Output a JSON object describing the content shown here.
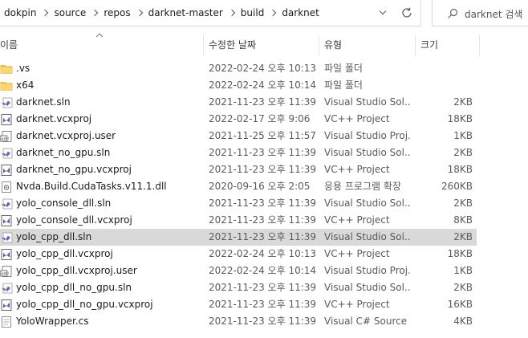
{
  "address_bar": {
    "crumbs": [
      "dokpin",
      "source",
      "repos",
      "darknet-master",
      "build",
      "darknet"
    ]
  },
  "search": {
    "placeholder": "darknet 검색"
  },
  "columns": {
    "name": "이름",
    "date": "수정한 날짜",
    "type": "유형",
    "size": "크기"
  },
  "files": [
    {
      "name": ".vs",
      "date": "2022-02-24 오후 10:13",
      "type": "파일 폴더",
      "size": "",
      "icon": "folder-icon"
    },
    {
      "name": "x64",
      "date": "2022-02-24 오후 10:14",
      "type": "파일 폴더",
      "size": "",
      "icon": "folder-icon"
    },
    {
      "name": "darknet.sln",
      "date": "2021-11-23 오후 11:39",
      "type": "Visual Studio Sol...",
      "size": "2KB",
      "icon": "sln-file-icon"
    },
    {
      "name": "darknet.vcxproj",
      "date": "2022-02-17 오후 9:06",
      "type": "VC++ Project",
      "size": "18KB",
      "icon": "vcxproj-file-icon"
    },
    {
      "name": "darknet.vcxproj.user",
      "date": "2021-11-25 오후 11:57",
      "type": "Visual Studio Proj...",
      "size": "1KB",
      "icon": "user-file-icon"
    },
    {
      "name": "darknet_no_gpu.sln",
      "date": "2021-11-23 오후 11:39",
      "type": "Visual Studio Sol...",
      "size": "2KB",
      "icon": "sln-file-icon"
    },
    {
      "name": "darknet_no_gpu.vcxproj",
      "date": "2021-11-23 오후 11:39",
      "type": "VC++ Project",
      "size": "18KB",
      "icon": "vcxproj-file-icon"
    },
    {
      "name": "Nvda.Build.CudaTasks.v11.1.dll",
      "date": "2020-09-16 오후 2:05",
      "type": "응용 프로그램 확장",
      "size": "260KB",
      "icon": "dll-file-icon"
    },
    {
      "name": "yolo_console_dll.sln",
      "date": "2021-11-23 오후 11:39",
      "type": "Visual Studio Sol...",
      "size": "2KB",
      "icon": "sln-file-icon"
    },
    {
      "name": "yolo_console_dll.vcxproj",
      "date": "2021-11-23 오후 11:39",
      "type": "VC++ Project",
      "size": "8KB",
      "icon": "vcxproj-file-icon"
    },
    {
      "name": "yolo_cpp_dll.sln",
      "date": "2021-11-23 오후 11:39",
      "type": "Visual Studio Sol...",
      "size": "2KB",
      "icon": "sln-file-icon",
      "selected": true
    },
    {
      "name": "yolo_cpp_dll.vcxproj",
      "date": "2022-02-24 오후 10:13",
      "type": "VC++ Project",
      "size": "18KB",
      "icon": "vcxproj-file-icon"
    },
    {
      "name": "yolo_cpp_dll.vcxproj.user",
      "date": "2022-02-24 오후 10:14",
      "type": "Visual Studio Proj...",
      "size": "1KB",
      "icon": "user-file-icon"
    },
    {
      "name": "yolo_cpp_dll_no_gpu.sln",
      "date": "2021-11-23 오후 11:39",
      "type": "Visual Studio Sol...",
      "size": "2KB",
      "icon": "sln-file-icon"
    },
    {
      "name": "yolo_cpp_dll_no_gpu.vcxproj",
      "date": "2021-11-23 오후 11:39",
      "type": "VC++ Project",
      "size": "16KB",
      "icon": "vcxproj-file-icon"
    },
    {
      "name": "YoloWrapper.cs",
      "date": "2021-11-23 오후 11:39",
      "type": "Visual C# Source ...",
      "size": "4KB",
      "icon": "cs-file-icon"
    }
  ]
}
